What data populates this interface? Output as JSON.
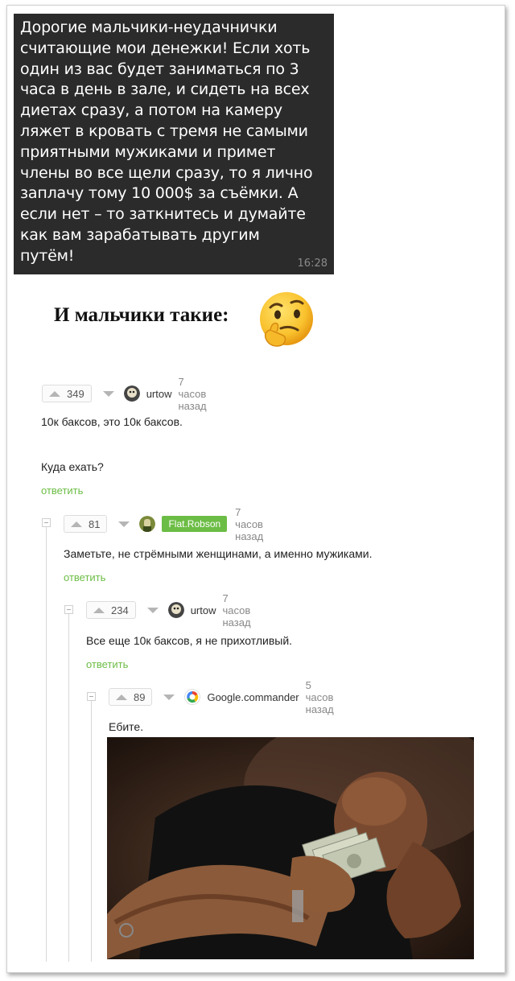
{
  "message": {
    "text": "Дорогие мальчики-неудачнички\nсчитающие мои денежки! Если хоть\nодин из вас будет заниматься по 3\nчаса в день в зале, и сидеть на всех\nдиетах сразу, а потом на камеру\nляжет в кровать с тремя не самыми\nприятными мужиками и примет\nчлены во все щели сразу, то я лично\nзаплачу тому 10 000$ за съёмки. А\nесли нет – то заткнитесь и думайте\nкак вам зарабатывать другим\nпутём!",
    "time": "16:28"
  },
  "caption": {
    "text": "И мальчики такие:",
    "emoji": "thinking-face"
  },
  "colors": {
    "reply_green": "#6cbd45",
    "bubble": "#2b2b2b"
  },
  "comments": [
    {
      "votes": "349",
      "user": "urtow",
      "time": "7 часов назад",
      "lines": [
        "10к баксов, это 10к баксов.",
        "Куда ехать?"
      ],
      "reply": "ответить"
    },
    {
      "votes": "81",
      "user": "Flat.Robson",
      "time": "7 часов назад",
      "lines": [
        "Заметьте, не стрёмными женщинами, а именно мужиками."
      ],
      "reply": "ответить"
    },
    {
      "votes": "234",
      "user": "urtow",
      "time": "7 часов назад",
      "lines": [
        "Все еще 10к баксов, я не прихотливый."
      ],
      "reply": "ответить"
    },
    {
      "votes": "89",
      "user": "Google.commander",
      "time": "5 часов назад",
      "lines": [
        "Ебите."
      ],
      "image": "man-crying-with-money-photo"
    }
  ]
}
